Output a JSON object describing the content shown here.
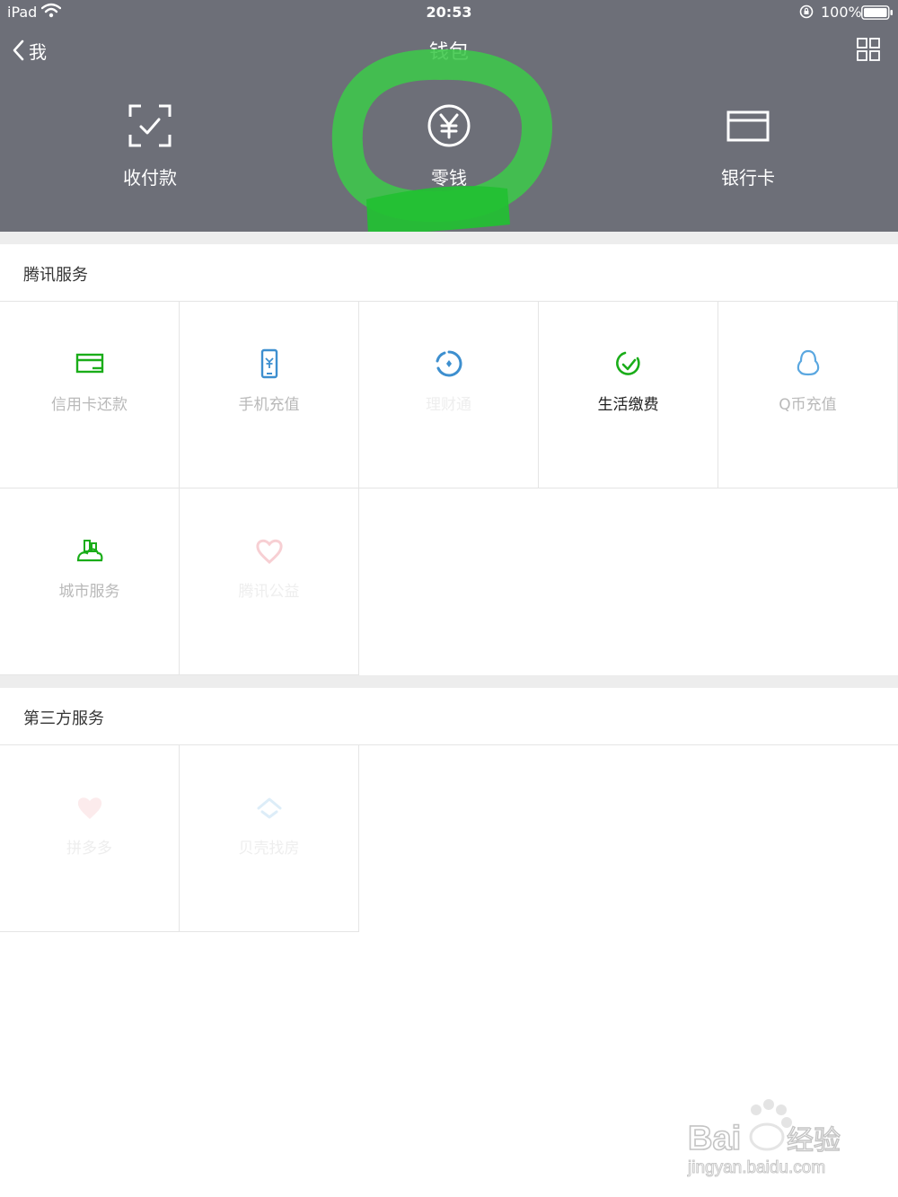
{
  "status_bar": {
    "device": "iPad",
    "time": "20:53",
    "battery": "100%"
  },
  "nav": {
    "back_label": "我",
    "title": "钱包"
  },
  "top_actions": [
    {
      "label": "收付款",
      "icon": "scan-pay-icon"
    },
    {
      "label": "零钱",
      "icon": "yuan-circle-icon"
    },
    {
      "label": "银行卡",
      "icon": "bank-card-icon"
    }
  ],
  "tencent_services": {
    "title": "腾讯服务",
    "items": [
      {
        "label": "信用卡还款",
        "icon": "credit-card-icon",
        "color": "#1aad19"
      },
      {
        "label": "手机充值",
        "icon": "mobile-recharge-icon",
        "color": "#3d8fcf"
      },
      {
        "label": "理财通",
        "icon": "licaitong-icon",
        "color": "#3d8fcf"
      },
      {
        "label": "生活缴费",
        "icon": "life-payment-icon",
        "color": "#1aad19"
      },
      {
        "label": "Q币充值",
        "icon": "penguin-icon",
        "color": "#5aa7e0"
      },
      {
        "label": "城市服务",
        "icon": "city-service-icon",
        "color": "#1aad19"
      },
      {
        "label": "腾讯公益",
        "icon": "charity-heart-icon",
        "color": "#f0a0a8"
      }
    ]
  },
  "third_party_services": {
    "title": "第三方服务",
    "items": [
      {
        "label": "拼多多",
        "icon": "pinduoduo-icon",
        "color": "#e8606a"
      },
      {
        "label": "贝壳找房",
        "icon": "beike-icon",
        "color": "#5aa7e0"
      }
    ]
  },
  "watermark": {
    "brand": "Bai",
    "brand_cn": "经验",
    "url": "jingyan.baidu.com"
  }
}
